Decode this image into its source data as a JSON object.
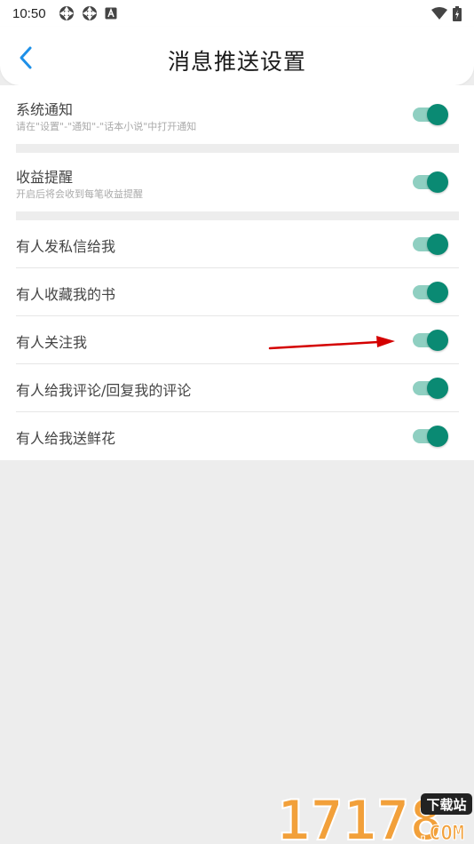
{
  "status_bar": {
    "time": "10:50",
    "icons_left": [
      "sync-icon",
      "sync-icon",
      "app-notification-icon"
    ],
    "icons_right": [
      "wifi-icon",
      "battery-icon"
    ]
  },
  "header": {
    "title": "消息推送设置",
    "back_icon": "chevron-left-icon"
  },
  "colors": {
    "accent": "#0a8a73",
    "track": "#8fcfc1",
    "arrow": "#d40000",
    "watermark_orange": "#f2a03a"
  },
  "settings": {
    "system_notice": {
      "title": "系统通知",
      "subtitle": "请在\"设置\"-\"通知\"-\"话本小说\"中打开通知",
      "enabled": true
    },
    "earnings_reminder": {
      "title": "收益提醒",
      "subtitle": "开启后将会收到每笔收益提醒",
      "enabled": true
    },
    "items": [
      {
        "title": "有人发私信给我",
        "enabled": true
      },
      {
        "title": "有人收藏我的书",
        "enabled": true
      },
      {
        "title": "有人关注我",
        "enabled": true
      },
      {
        "title": "有人给我评论/回复我的评论",
        "enabled": true
      },
      {
        "title": "有人给我送鲜花",
        "enabled": true
      }
    ]
  },
  "watermark": {
    "text": "17178",
    "badge": "下载站",
    "domain": ".COM"
  }
}
